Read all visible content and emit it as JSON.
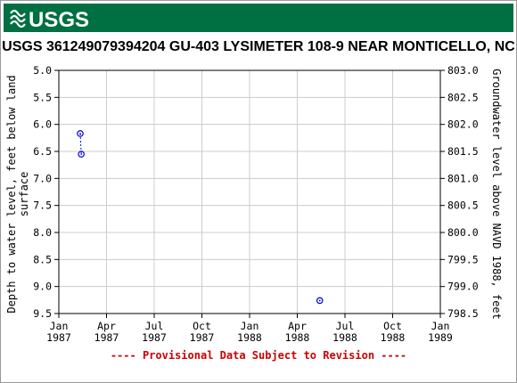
{
  "header": {
    "logo_text": "USGS",
    "brand_color": "#006f41"
  },
  "chart_data": {
    "type": "scatter",
    "title": "USGS 361249079394204 GU-403 LYSIMETER 108-9 NEAR MONTICELLO, NC",
    "ylabel_left": [
      "Depth to water level, feet below land",
      "surface"
    ],
    "ylabel_right": "Groundwater level above NAVD 1988, feet",
    "x_ticks": [
      {
        "line1": "Jan",
        "line2": "1987"
      },
      {
        "line1": "Apr",
        "line2": "1987"
      },
      {
        "line1": "Jul",
        "line2": "1987"
      },
      {
        "line1": "Oct",
        "line2": "1987"
      },
      {
        "line1": "Jan",
        "line2": "1988"
      },
      {
        "line1": "Apr",
        "line2": "1988"
      },
      {
        "line1": "Jul",
        "line2": "1988"
      },
      {
        "line1": "Oct",
        "line2": "1988"
      },
      {
        "line1": "Jan",
        "line2": "1989"
      }
    ],
    "y_left_ticks": [
      "5.0",
      "5.5",
      "6.0",
      "6.5",
      "7.0",
      "7.5",
      "8.0",
      "8.5",
      "9.0",
      "9.5"
    ],
    "y_right_ticks": [
      "803.0",
      "802.5",
      "802.0",
      "801.5",
      "801.0",
      "800.5",
      "800.0",
      "799.5",
      "799.0",
      "798.5"
    ],
    "ylim_left": [
      5.0,
      9.5
    ],
    "ylim_right": [
      803.0,
      798.5
    ],
    "xlim": [
      "1987-01-01",
      "1989-01-01"
    ],
    "grid": true,
    "marker_color": "#0000cc",
    "points": [
      {
        "x": "1987-02-11",
        "y": 6.17
      },
      {
        "x": "1987-02-13",
        "y": 6.55
      },
      {
        "x": "1988-05-15",
        "y": 9.26
      }
    ],
    "connected_pairs": [
      [
        0,
        1
      ]
    ]
  },
  "footnote": {
    "text": "---- Provisional Data Subject to Revision ----",
    "color": "#cc0000"
  }
}
